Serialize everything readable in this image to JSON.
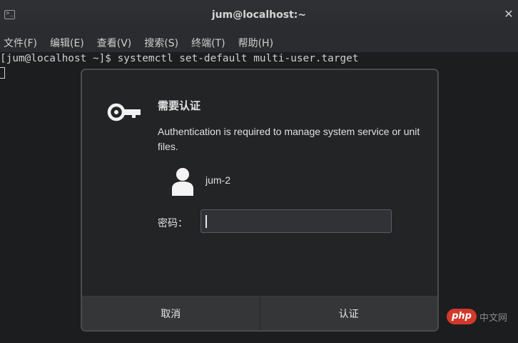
{
  "window": {
    "title": "jum@localhost:~",
    "terminal_icon": "terminal-icon",
    "close_glyph": "✕"
  },
  "menu": {
    "items": [
      "文件(F)",
      "编辑(E)",
      "查看(V)",
      "搜索(S)",
      "终端(T)",
      "帮助(H)"
    ]
  },
  "terminal": {
    "command_line": "[jum@localhost ~]$ systemctl set-default multi-user.target"
  },
  "dialog": {
    "heading": "需要认证",
    "message": "Authentication is required to manage system service or unit files.",
    "user": "jum-2",
    "password_label": "密码：",
    "password_value": "",
    "cancel_label": "取消",
    "authenticate_label": "认证"
  },
  "watermark": {
    "logo_text": "php",
    "site_text": "中文网"
  },
  "colors": {
    "background": "#1c1d1f",
    "dialog_bg": "#232426",
    "button_bg": "#353638",
    "watermark_red": "#d0392b"
  }
}
